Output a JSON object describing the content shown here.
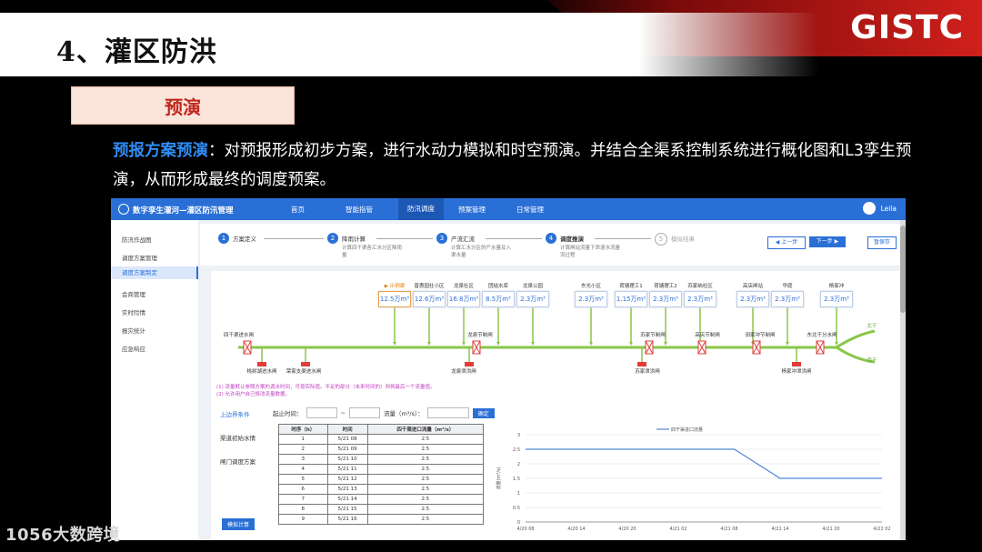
{
  "slide": {
    "title": "4、灌区防洪",
    "logo": "GISTC",
    "section_tag": "预演",
    "desc_highlight": "预报方案预演",
    "desc_rest": "：对预报形成初步方案，进行水动力模拟和时空预演。并结合全渠系控制系统进行概化图和L3孪生预演，从而形成最终的调度预案。",
    "watermark": "1056大数跨境"
  },
  "app": {
    "brand": "数字孪生灌河—灌区防汛管理",
    "nav": [
      "首页",
      "智能指管",
      "防汛调度",
      "预案管理",
      "日常管理"
    ],
    "user": "Leila",
    "sidebar": [
      "防汛作战图",
      "调度方案管理",
      "调度方案制定",
      "会商管理",
      "实时险情",
      "报灾统计",
      "应急响应"
    ],
    "steps": [
      {
        "n": "1",
        "label": "方案定义",
        "sub": ""
      },
      {
        "n": "2",
        "label": "降雨计算",
        "sub": "计算四干渠各汇水分区降雨量"
      },
      {
        "n": "3",
        "label": "产流汇流",
        "sub": "计算汇水分区的产水量及入渠水量"
      },
      {
        "n": "4",
        "label": "调度推演",
        "sub": "计算闸站流量下泄退水流量流过程"
      },
      {
        "n": "5",
        "label": "模拟结果",
        "sub": ""
      }
    ],
    "buttons": {
      "prev": "◀ 上一步",
      "next": "下一步 ▶",
      "save": "暂保存"
    },
    "nodes": [
      {
        "name": "▶ 示例渠",
        "value": "12.5万m³"
      },
      {
        "name": "普惠园社小区",
        "value": "12.6万m³"
      },
      {
        "name": "龙泉社区",
        "value": "16.8万m³"
      },
      {
        "name": "团结水库",
        "value": "8.5万m³"
      },
      {
        "name": "龙泉公园",
        "value": "2.3万m³"
      },
      {
        "name": "东光小区",
        "value": "2.3万m³"
      },
      {
        "name": "荷塘理工1",
        "value": "1.15万m³"
      },
      {
        "name": "荷塘理工2",
        "value": "2.3万m³"
      },
      {
        "name": "苏家纳社区",
        "value": "2.3万m³"
      },
      {
        "name": "高店闸站",
        "value": "2.3万m³"
      },
      {
        "name": "华庭",
        "value": "2.3万m³"
      },
      {
        "name": "杨家冲",
        "value": "2.3万m³"
      }
    ],
    "gates_top": [
      "四干渠进水闸",
      "龙泉节制闸",
      "苏家节制闸",
      "高店节制闸",
      "田家冲节制闸",
      "东北干分水闸"
    ],
    "gates_bottom": [
      "桃树湖进水闸",
      "荣家支渠进水闸",
      "龙泉泄洪闸",
      "苏家泄洪闸",
      "杨家冲泄洪闸"
    ],
    "branches": [
      "北干",
      "南干"
    ],
    "notes": [
      "(1) 流量默认参照方案的调水时间，可按实际值。不足的部分（未来时间的）则将最后一个流量值。",
      "(2) 允许用户自己修改流量数据。"
    ],
    "tabs": [
      "上边界条件",
      "渠道初始水情",
      "闸门调度方案"
    ],
    "filter": {
      "start_label": "起止时间：",
      "tilde": "~",
      "flow_label": "流量（m³/s）：",
      "confirm": "确定"
    },
    "table": {
      "headers": [
        "时序（h）",
        "时间",
        "四干渠进口流量（m³/s）"
      ],
      "rows": [
        [
          "1",
          "5/21 08",
          "2.5"
        ],
        [
          "2",
          "5/21 09",
          "2.5"
        ],
        [
          "3",
          "5/21 10",
          "2.5"
        ],
        [
          "4",
          "5/21 11",
          "2.5"
        ],
        [
          "5",
          "5/21 12",
          "2.5"
        ],
        [
          "6",
          "5/21 13",
          "2.5"
        ],
        [
          "7",
          "5/21 14",
          "2.5"
        ],
        [
          "8",
          "5/21 15",
          "2.5"
        ],
        [
          "9",
          "5/21 16",
          "2.5"
        ]
      ]
    },
    "calc_button": "模拟计算"
  },
  "chart_data": {
    "type": "line",
    "title": "",
    "legend": [
      "四干渠进口流量"
    ],
    "xlabel": "",
    "ylabel": "流量(m³/s)",
    "x_ticks": [
      "4/20 08",
      "4/20 14",
      "4/20 20",
      "4/21 02",
      "4/21 08",
      "4/21 14",
      "4/21 20",
      "4/22 02"
    ],
    "y_ticks": [
      "0",
      "0.5",
      "1",
      "1.5",
      "2",
      "2.5",
      "3"
    ],
    "ylim": [
      0,
      3
    ],
    "series": [
      {
        "name": "四干渠进口流量",
        "x": [
          0,
          1,
          2,
          3,
          4,
          4.1,
          5,
          6,
          7
        ],
        "values": [
          2.5,
          2.5,
          2.5,
          2.5,
          2.5,
          2.5,
          1.5,
          1.5,
          1.5
        ]
      }
    ],
    "colors": {
      "line": "#4f86d9"
    }
  }
}
